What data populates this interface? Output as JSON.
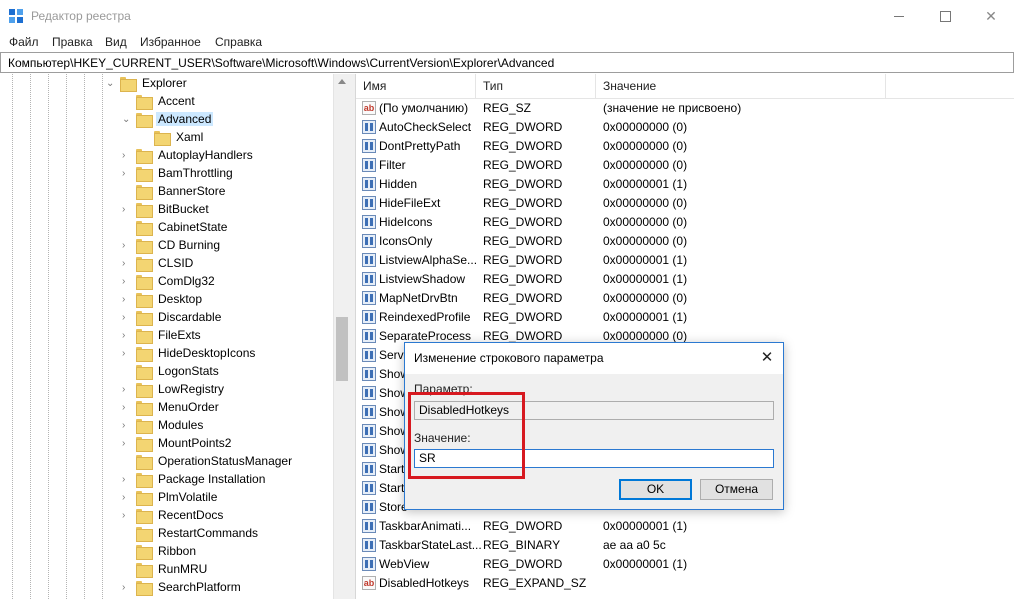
{
  "window": {
    "title": "Редактор реестра"
  },
  "menu": [
    "Файл",
    "Правка",
    "Вид",
    "Избранное",
    "Справка"
  ],
  "address": "Компьютер\\HKEY_CURRENT_USER\\Software\\Microsoft\\Windows\\CurrentVersion\\Explorer\\Advanced",
  "tree": [
    {
      "label": "Explorer",
      "expander": "expanded"
    },
    {
      "label": "Accent",
      "expander": "none"
    },
    {
      "label": "Advanced",
      "expander": "expanded",
      "selected": true
    },
    {
      "label": "Xaml",
      "expander": "none"
    },
    {
      "label": "AutoplayHandlers",
      "expander": "collapsed"
    },
    {
      "label": "BamThrottling",
      "expander": "collapsed"
    },
    {
      "label": "BannerStore",
      "expander": "none"
    },
    {
      "label": "BitBucket",
      "expander": "collapsed"
    },
    {
      "label": "CabinetState",
      "expander": "none"
    },
    {
      "label": "CD Burning",
      "expander": "collapsed"
    },
    {
      "label": "CLSID",
      "expander": "collapsed"
    },
    {
      "label": "ComDlg32",
      "expander": "collapsed"
    },
    {
      "label": "Desktop",
      "expander": "collapsed"
    },
    {
      "label": "Discardable",
      "expander": "collapsed"
    },
    {
      "label": "FileExts",
      "expander": "collapsed"
    },
    {
      "label": "HideDesktopIcons",
      "expander": "collapsed"
    },
    {
      "label": "LogonStats",
      "expander": "none"
    },
    {
      "label": "LowRegistry",
      "expander": "collapsed"
    },
    {
      "label": "MenuOrder",
      "expander": "collapsed"
    },
    {
      "label": "Modules",
      "expander": "collapsed"
    },
    {
      "label": "MountPoints2",
      "expander": "collapsed"
    },
    {
      "label": "OperationStatusManager",
      "expander": "none"
    },
    {
      "label": "Package Installation",
      "expander": "collapsed"
    },
    {
      "label": "PlmVolatile",
      "expander": "collapsed"
    },
    {
      "label": "RecentDocs",
      "expander": "collapsed"
    },
    {
      "label": "RestartCommands",
      "expander": "none"
    },
    {
      "label": "Ribbon",
      "expander": "none"
    },
    {
      "label": "RunMRU",
      "expander": "none"
    },
    {
      "label": "SearchPlatform",
      "expander": "collapsed"
    }
  ],
  "columns": {
    "name": "Имя",
    "type": "Тип",
    "data": "Значение"
  },
  "values": [
    {
      "icon": "string-value-icon",
      "name": "(По умолчанию)",
      "type": "REG_SZ",
      "data": "(значение не присвоено)"
    },
    {
      "icon": "binary-value-icon",
      "name": "AutoCheckSelect",
      "type": "REG_DWORD",
      "data": "0x00000000 (0)"
    },
    {
      "icon": "binary-value-icon",
      "name": "DontPrettyPath",
      "type": "REG_DWORD",
      "data": "0x00000000 (0)"
    },
    {
      "icon": "binary-value-icon",
      "name": "Filter",
      "type": "REG_DWORD",
      "data": "0x00000000 (0)"
    },
    {
      "icon": "binary-value-icon",
      "name": "Hidden",
      "type": "REG_DWORD",
      "data": "0x00000001 (1)"
    },
    {
      "icon": "binary-value-icon",
      "name": "HideFileExt",
      "type": "REG_DWORD",
      "data": "0x00000000 (0)"
    },
    {
      "icon": "binary-value-icon",
      "name": "HideIcons",
      "type": "REG_DWORD",
      "data": "0x00000000 (0)"
    },
    {
      "icon": "binary-value-icon",
      "name": "IconsOnly",
      "type": "REG_DWORD",
      "data": "0x00000000 (0)"
    },
    {
      "icon": "binary-value-icon",
      "name": "ListviewAlphaSe...",
      "type": "REG_DWORD",
      "data": "0x00000001 (1)"
    },
    {
      "icon": "binary-value-icon",
      "name": "ListviewShadow",
      "type": "REG_DWORD",
      "data": "0x00000001 (1)"
    },
    {
      "icon": "binary-value-icon",
      "name": "MapNetDrvBtn",
      "type": "REG_DWORD",
      "data": "0x00000000 (0)"
    },
    {
      "icon": "binary-value-icon",
      "name": "ReindexedProfile",
      "type": "REG_DWORD",
      "data": "0x00000001 (1)"
    },
    {
      "icon": "binary-value-icon",
      "name": "SeparateProcess",
      "type": "REG_DWORD",
      "data": "0x00000000 (0)"
    },
    {
      "icon": "binary-value-icon",
      "name": "Serve",
      "type": "",
      "data": ""
    },
    {
      "icon": "binary-value-icon",
      "name": "Show",
      "type": "",
      "data": ""
    },
    {
      "icon": "binary-value-icon",
      "name": "Show",
      "type": "",
      "data": ""
    },
    {
      "icon": "binary-value-icon",
      "name": "Show",
      "type": "",
      "data": ""
    },
    {
      "icon": "binary-value-icon",
      "name": "Show",
      "type": "",
      "data": ""
    },
    {
      "icon": "binary-value-icon",
      "name": "Show",
      "type": "",
      "data": ""
    },
    {
      "icon": "binary-value-icon",
      "name": "Start",
      "type": "",
      "data": ""
    },
    {
      "icon": "binary-value-icon",
      "name": "Start",
      "type": "",
      "data": ""
    },
    {
      "icon": "binary-value-icon",
      "name": "Store",
      "type": "",
      "data": ""
    },
    {
      "icon": "binary-value-icon",
      "name": "TaskbarAnimati...",
      "type": "REG_DWORD",
      "data": "0x00000001 (1)"
    },
    {
      "icon": "binary-value-icon",
      "name": "TaskbarStateLast...",
      "type": "REG_BINARY",
      "data": "ae aa a0 5c"
    },
    {
      "icon": "binary-value-icon",
      "name": "WebView",
      "type": "REG_DWORD",
      "data": "0x00000001 (1)"
    },
    {
      "icon": "string-value-icon",
      "name": "DisabledHotkeys",
      "type": "REG_EXPAND_SZ",
      "data": ""
    }
  ],
  "dialog": {
    "title": "Изменение строкового параметра",
    "param_label": "Параметр:",
    "param_value": "DisabledHotkeys",
    "value_label": "Значение:",
    "value_value": "SR",
    "ok_label": "OK",
    "cancel_label": "Отмена"
  },
  "colors": {
    "highlight": "#d71920",
    "selection": "#cce8ff",
    "accent": "#0078d7"
  }
}
